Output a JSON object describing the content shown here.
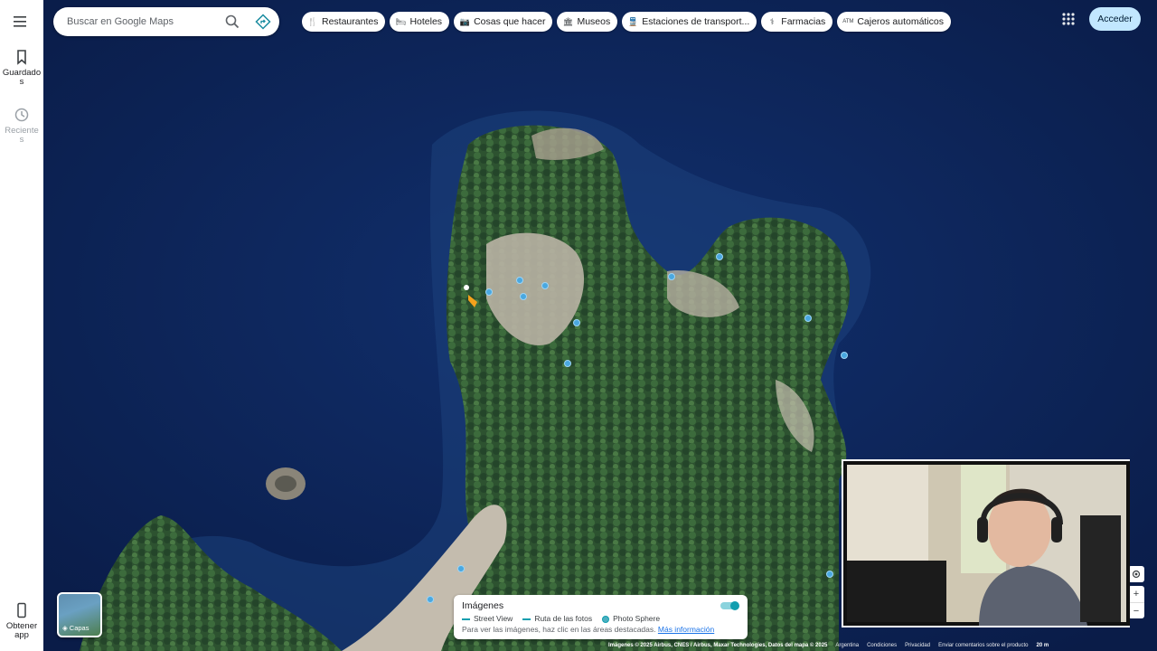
{
  "search": {
    "placeholder": "Buscar en Google Maps"
  },
  "rail": {
    "saved": "Guardado\ns",
    "saved_line1": "Guardado",
    "saved_line2": "s",
    "recent_line1": "Reciente",
    "recent_line2": "s",
    "get_app_line1": "Obtener",
    "get_app_line2": "app"
  },
  "chips": [
    {
      "label": "Restaurantes",
      "icon": "restaurant-icon"
    },
    {
      "label": "Hoteles",
      "icon": "hotel-icon"
    },
    {
      "label": "Cosas que hacer",
      "icon": "camera-icon"
    },
    {
      "label": "Museos",
      "icon": "museum-icon"
    },
    {
      "label": "Estaciones de transport...",
      "icon": "transit-icon"
    },
    {
      "label": "Farmacias",
      "icon": "pharmacy-icon"
    },
    {
      "label": "Cajeros automáticos",
      "icon": "atm-icon"
    }
  ],
  "header": {
    "sign_in": "Acceder"
  },
  "layers": {
    "label": "Capas"
  },
  "legend": {
    "title": "Imágenes",
    "street_view": "Street View",
    "photo_route": "Ruta de las fotos",
    "photo_sphere": "Photo Sphere",
    "hint": "Para ver las imágenes, haz clic en las áreas destacadas.",
    "more_info": "Más información",
    "toggle_on": true
  },
  "footer": {
    "attribution": "Imágenes © 2025 Airbus, CNES / Airbus, Maxar Technologies, Datos del mapa © 2025",
    "country": "Argentina",
    "terms": "Condiciones",
    "privacy": "Privacidad",
    "feedback": "Enviar comentarios sobre el producto",
    "scale": "20 m"
  },
  "colors": {
    "water": "#0c2357",
    "forest": "#2f5a33",
    "rock": "#b9b2a4",
    "accent": "#c2e7ff",
    "link": "#1a73e8",
    "street_view_line": "#129eaf"
  }
}
